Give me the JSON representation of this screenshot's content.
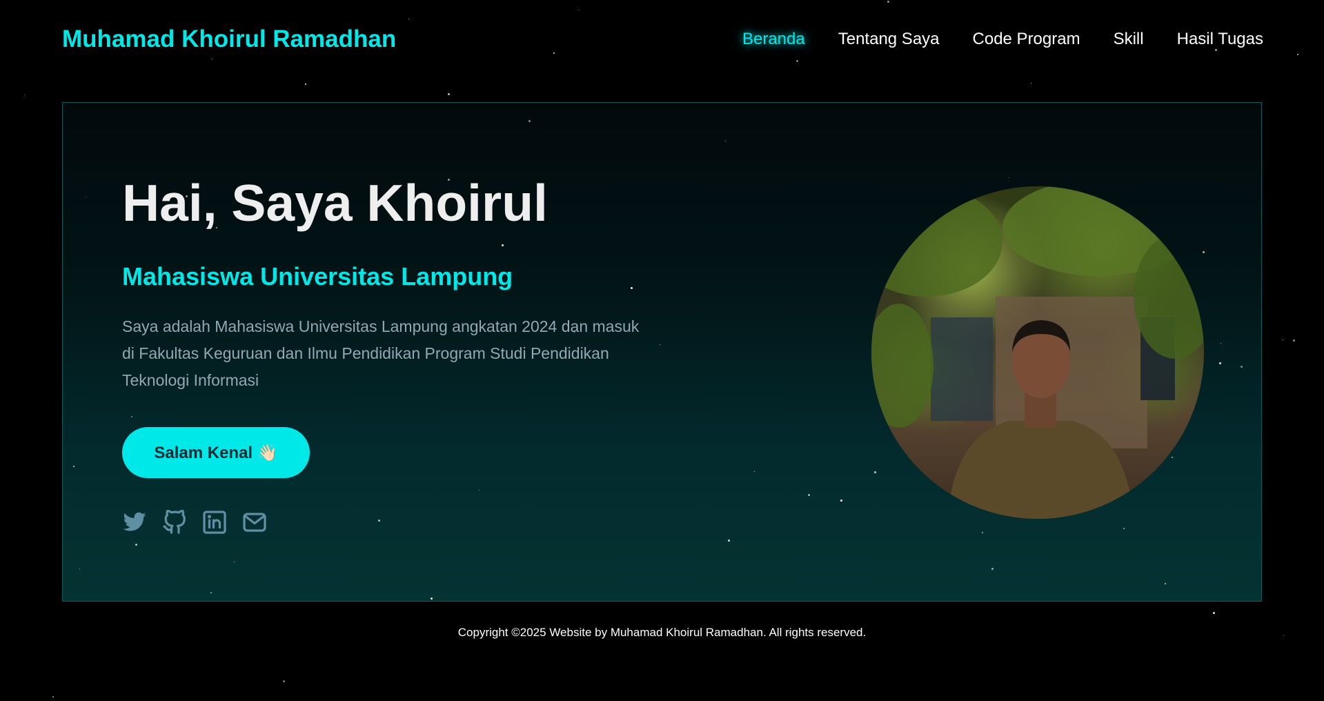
{
  "header": {
    "brand": "Muhamad Khoirul Ramadhan",
    "nav": [
      {
        "label": "Beranda",
        "active": true
      },
      {
        "label": "Tentang Saya",
        "active": false
      },
      {
        "label": "Code Program",
        "active": false
      },
      {
        "label": "Skill",
        "active": false
      },
      {
        "label": "Hasil Tugas",
        "active": false
      }
    ]
  },
  "hero": {
    "greeting": "Hai, Saya Khoirul",
    "subtitle": "Mahasiswa Universitas Lampung",
    "description": "Saya adalah Mahasiswa Universitas Lampung angkatan 2024 dan masuk di Fakultas Keguruan dan Ilmu Pendidikan Program Studi Pendidikan Teknologi Informasi",
    "cta_label": "Salam Kenal 👋🏻",
    "socials": [
      "twitter-icon",
      "github-icon",
      "linkedin-icon",
      "mail-icon"
    ],
    "photo_alt": "profile-photo"
  },
  "footer": {
    "copyright": "Copyright ©2025 Website by Muhamad Khoirul Ramadhan. All rights reserved."
  },
  "colors": {
    "accent": "#00e8e8",
    "background": "#000000",
    "muted_text": "#94a8b4",
    "icon": "#5f8fa3"
  }
}
